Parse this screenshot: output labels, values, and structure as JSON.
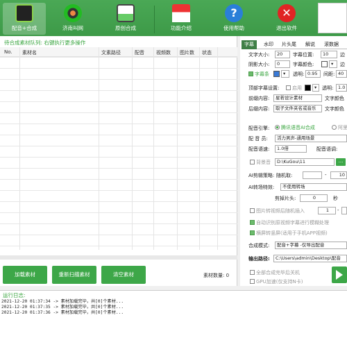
{
  "toolbar": {
    "items": [
      {
        "label": "配音+合成",
        "icon": "clapperboard-icon"
      },
      {
        "label": "济南叫网",
        "icon": "film-reel-icon"
      },
      {
        "label": "原创合成",
        "icon": "image-icon"
      },
      {
        "label": "功能介绍",
        "icon": "home-icon"
      },
      {
        "label": "使用帮助",
        "icon": "help-icon"
      },
      {
        "label": "退出软件",
        "icon": "close-icon"
      }
    ]
  },
  "queue": {
    "title": "待合成素材队列: 右键执行更多操作",
    "columns": [
      "No.",
      "素材名",
      "文素路径",
      "配音",
      "视频数",
      "图片数",
      "状态"
    ],
    "buttons": [
      "加载素材",
      "重新扫描素材",
      "清空素材"
    ],
    "count_label": "素材数量: 0"
  },
  "settings": {
    "tabs": [
      "字幕",
      "水印",
      "片头尾",
      "解说",
      "滚数据"
    ],
    "font_size_label": "文字大小:",
    "font_size": "20",
    "pos_label": "字幕位置:",
    "pos": "10",
    "edge_label": "边",
    "shadow_label": "阴影大小:",
    "shadow": "0",
    "color_label": "字幕颜色:",
    "edge2_label": "边",
    "bar_label": "字幕条",
    "alpha_label": "透明:",
    "alpha": "0.95",
    "spacing_label": "间距:",
    "spacing": "40",
    "top_sub_label": "顶部字幕设置:",
    "enable_label": "启用",
    "alpha2_label": "透明:",
    "alpha2": "1.0",
    "front_label": "前缀内容:",
    "front_value": "星若设计素材",
    "text_color_label": "文字颜色",
    "back_label": "后缀内容:",
    "back_value": "取子文件夹名或音乐",
    "text_color2_label": "文字颜色",
    "engine_label": "配音引擎:",
    "engine_opt1": "腾讯语音AI合成",
    "engine_opt2": "阿里",
    "voice_label": "配 音 员:",
    "voice_value": "活力男声-通用场景",
    "speed_label": "配音语速:",
    "speed_value": "1.0倍",
    "tone_label": "配音语调:",
    "bgm_label": "背景音",
    "bgm_path": "D:\\KuGou\\11",
    "ai_cut_label": "AI剪辑策略:",
    "random_label": "随机取:",
    "random_sep": "-",
    "random_to": "10",
    "ai_trans_label": "AI转场特效:",
    "ai_trans_value": "不使用转场",
    "cut_head_label": "剪掉片头:",
    "cut_head_value": "0",
    "sec_label": "秒",
    "img_to_video_label": "图片转视频后随机插入",
    "img_min": "1",
    "img_sep": "-",
    "auto_sub_label": "自动识别原视频字幕进行模糊处理",
    "landscape_label": "横屏转竖屏(适用于手机APP视频)",
    "mode_label": "合成模式:",
    "mode_value": "配音+字幕 -仅导出配音",
    "output_label": "输出路径:",
    "output_value": "C:\\Users\\admin\\Desktop\\配音",
    "shutdown_label": "全部合成完毕后关机",
    "gpu_label": "GPU加速(仅支持N卡)"
  },
  "log": {
    "title": "运行日志:",
    "lines": [
      "2021-12-20 01:37:34 -> 素材加载完毕，共[0]个素材...",
      "2021-12-20 01:37:35 -> 素材加载完毕，共[0]个素材...",
      "2021-12-20 01:37:36 -> 素材加载完毕，共[0]个素材..."
    ]
  },
  "colors": {
    "accent": "#3da748",
    "topbar": "#4aa855"
  }
}
